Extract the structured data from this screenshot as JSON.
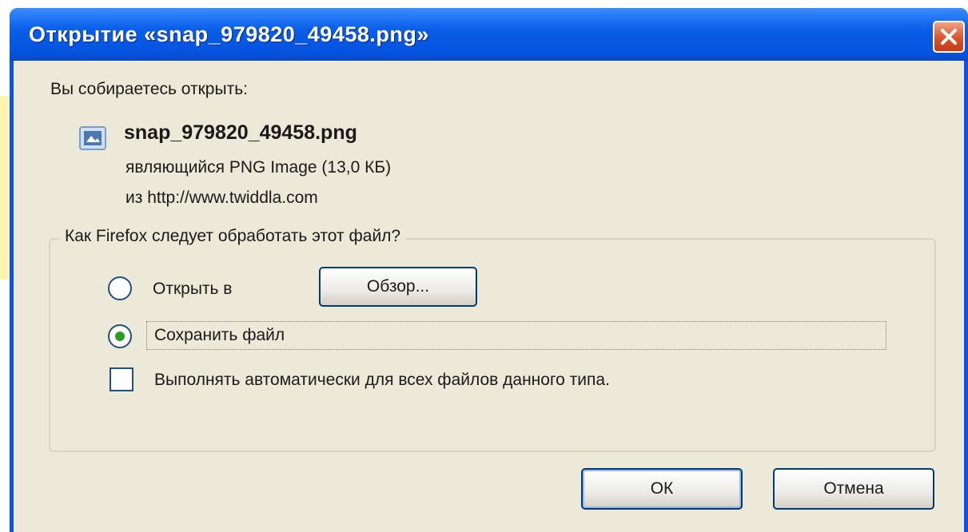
{
  "dialog": {
    "title": "Открытие «snap_979820_49458.png»",
    "prompt": "Вы собираетесь открыть:",
    "file": {
      "name": "snap_979820_49458.png",
      "type_line": "являющийся  PNG Image (13,0 КБ)",
      "source_line": "из  http://www.twiddla.com",
      "icon": "png-file-icon"
    },
    "action_group": {
      "label": "Как Firefox следует обработать этот файл?",
      "open_with_label": "Открыть в",
      "browse_label": "Обзор...",
      "save_label": "Сохранить файл",
      "selected": "save",
      "auto_label": "Выполнять автоматически для всех файлов данного типа.",
      "auto_checked": false
    },
    "buttons": {
      "ok": "ОК",
      "cancel": "Отмена"
    }
  },
  "colors": {
    "titlebar": "#0a5ee8",
    "dialog_bg": "#ece9d8",
    "close_button": "#d9532d",
    "radio_selected": "#2c9c1e"
  }
}
